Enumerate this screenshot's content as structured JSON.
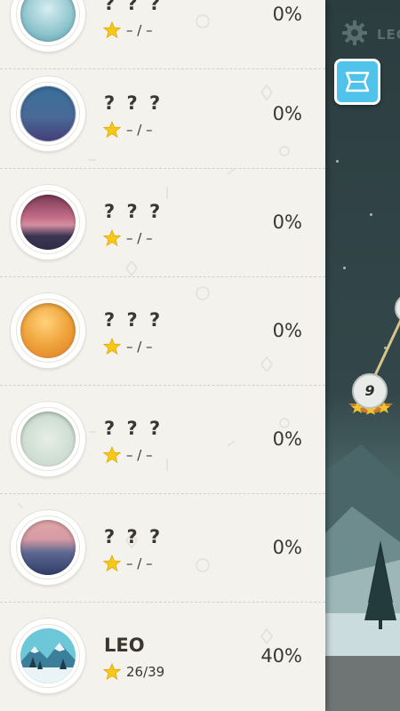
{
  "constellations": [
    {
      "name": "? ? ?",
      "score": "– / –",
      "percent": "0%",
      "thumb": "ice"
    },
    {
      "name": "? ? ?",
      "score": "– / –",
      "percent": "0%",
      "thumb": "deep-blue"
    },
    {
      "name": "? ? ?",
      "score": "– / –",
      "percent": "0%",
      "thumb": "sunset-pink"
    },
    {
      "name": "? ? ?",
      "score": "– / –",
      "percent": "0%",
      "thumb": "desert-orange"
    },
    {
      "name": "? ? ?",
      "score": "– / –",
      "percent": "0%",
      "thumb": "pale-mint"
    },
    {
      "name": "? ? ?",
      "score": "– / –",
      "percent": "0%",
      "thumb": "dusk-mountain"
    },
    {
      "name": "LEO",
      "score": "26/39",
      "percent": "40%",
      "thumb": "winter-mountain"
    }
  ],
  "map": {
    "current_constellation": "LEO",
    "level_number": "9",
    "settings_icon": "gear-icon",
    "map_button_icon": "map-icon"
  },
  "colors": {
    "panel_bg": "#f3f2ec",
    "text": "#3b3630",
    "star": "#f7c818",
    "map_button": "#4fc3ea"
  }
}
